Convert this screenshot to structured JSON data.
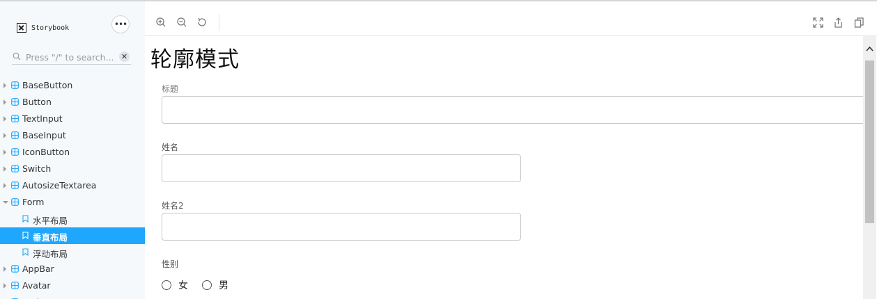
{
  "sidebar": {
    "brand": "Storybook",
    "menu_label": "•••",
    "search": {
      "placeholder": "Press \"/\" to search...",
      "value": "",
      "clear_label": "✕"
    },
    "items": [
      {
        "label": "BaseButton",
        "type": "component",
        "expanded": false
      },
      {
        "label": "Button",
        "type": "component",
        "expanded": false
      },
      {
        "label": "TextInput",
        "type": "component",
        "expanded": false
      },
      {
        "label": "BaseInput",
        "type": "component",
        "expanded": false
      },
      {
        "label": "IconButton",
        "type": "component",
        "expanded": false
      },
      {
        "label": "Switch",
        "type": "component",
        "expanded": false
      },
      {
        "label": "AutosizeTextarea",
        "type": "component",
        "expanded": false
      },
      {
        "label": "Form",
        "type": "component",
        "expanded": true
      },
      {
        "label": "水平布局",
        "type": "story",
        "selected": false
      },
      {
        "label": "垂直布局",
        "type": "story",
        "selected": true
      },
      {
        "label": "浮动布局",
        "type": "story",
        "selected": false
      },
      {
        "label": "AppBar",
        "type": "component",
        "expanded": false
      },
      {
        "label": "Avatar",
        "type": "component",
        "expanded": false
      },
      {
        "label": "Badge",
        "type": "component",
        "expanded": false
      }
    ]
  },
  "toolbar": {
    "left_icons": [
      "zoom-in-icon",
      "zoom-out-icon",
      "reset-zoom-icon"
    ],
    "right_icons": [
      "fullscreen-icon",
      "share-icon",
      "copy-icon"
    ]
  },
  "preview": {
    "title": "轮廓模式",
    "fields": [
      {
        "label": "标题",
        "value": ""
      },
      {
        "label": "姓名",
        "value": ""
      },
      {
        "label": "姓名2",
        "value": ""
      }
    ],
    "gender": {
      "label": "性别",
      "options": [
        "女",
        "男"
      ],
      "selected": null
    }
  },
  "colors": {
    "accent": "#1ea7fd",
    "sidebar_bg": "#f6f9fc",
    "icon_color": "#1ea7fd"
  }
}
